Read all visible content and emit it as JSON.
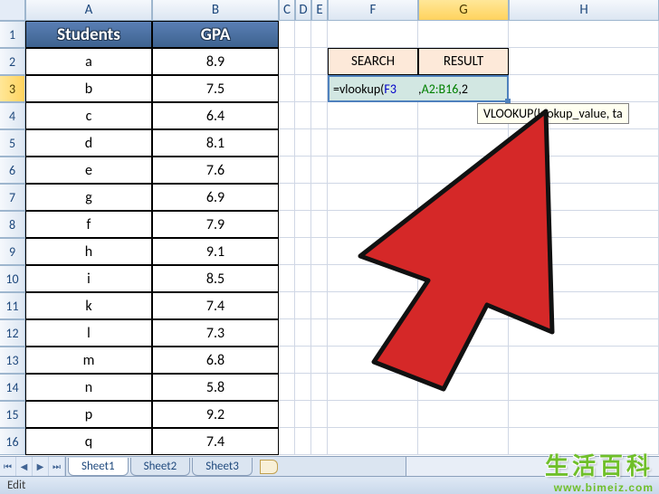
{
  "columns": [
    "A",
    "B",
    "C",
    "D",
    "E",
    "F",
    "G",
    "H"
  ],
  "rows": [
    "1",
    "2",
    "3",
    "4",
    "5",
    "6",
    "7",
    "8",
    "9",
    "10",
    "11",
    "12",
    "13",
    "14",
    "15",
    "16"
  ],
  "selected_col": "G",
  "selected_row": "3",
  "table": {
    "headers": {
      "students": "Students",
      "gpa": "GPA"
    },
    "data": [
      {
        "s": "a",
        "g": "8.9"
      },
      {
        "s": "b",
        "g": "7.5"
      },
      {
        "s": "c",
        "g": "6.4"
      },
      {
        "s": "d",
        "g": "8.1"
      },
      {
        "s": "e",
        "g": "7.6"
      },
      {
        "s": "g",
        "g": "6.9"
      },
      {
        "s": "f",
        "g": "7.9"
      },
      {
        "s": "h",
        "g": "9.1"
      },
      {
        "s": "i",
        "g": "8.5"
      },
      {
        "s": "k",
        "g": "7.4"
      },
      {
        "s": "l",
        "g": "7.3"
      },
      {
        "s": "m",
        "g": "6.8"
      },
      {
        "s": "n",
        "g": "5.8"
      },
      {
        "s": "p",
        "g": "9.2"
      },
      {
        "s": "q",
        "g": "7.4"
      }
    ]
  },
  "lookup": {
    "search_label": "SEARCH",
    "result_label": "RESULT",
    "formula_prefix": "=vlookup(",
    "formula_arg1": "F3",
    "formula_sep1": ",",
    "formula_arg2": "A2:B16",
    "formula_sep2": ",",
    "formula_arg3": "2",
    "tooltip": "VLOOKUP(lookup_value, ta"
  },
  "sheets": {
    "s1": "Sheet1",
    "s2": "Sheet2",
    "s3": "Sheet3"
  },
  "status": "Edit",
  "watermark": {
    "cn": "生活百科",
    "url": "www.bimeiz.com"
  }
}
